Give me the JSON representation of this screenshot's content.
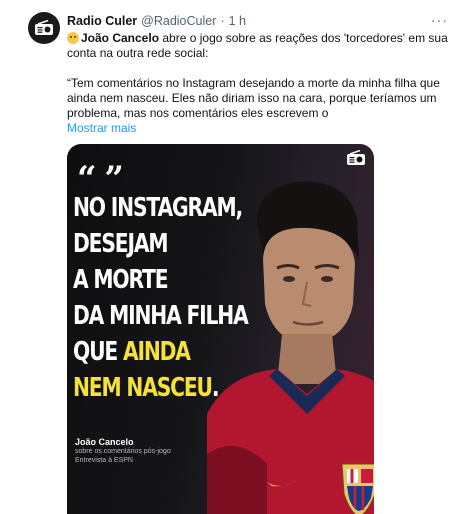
{
  "tweet": {
    "author_name": "Radio Culer",
    "author_handle": "@RadioCuler",
    "separator": "·",
    "time": "1 h",
    "more_icon": "more-horizontal-icon",
    "line1_name": "João Cancelo",
    "line1_rest": " abre o jogo sobre as reações dos 'torcedores' em sua",
    "line2": "conta na outra rede social:",
    "quote_line1": "“Tem comentários no Instagram desejando a morte da minha filha que",
    "quote_line2": "ainda nem nasceu. Eles não diriam isso na cara, porque teríamos um",
    "quote_line3": "problema, mas nos comentários eles escrevem o",
    "show_more": "Mostrar mais"
  },
  "media": {
    "quote_mark": "“ ”",
    "headline_lines": [
      "NO INSTAGRAM,",
      "DESEJAM",
      "A MORTE",
      "DA MINHA FILHA"
    ],
    "headline_line5_pre": "QUE ",
    "headline_line5_highlight": "AINDA",
    "headline_line6_highlight": "NEM NASCEU",
    "headline_line6_post": ".",
    "caption_name": "João Cancelo",
    "caption_line1": "sobre os comentários pós-jogo",
    "caption_line2": "Entrevista à ESPN",
    "highlight_color": "#f4e23a",
    "jersey_color": "#b3162f"
  }
}
